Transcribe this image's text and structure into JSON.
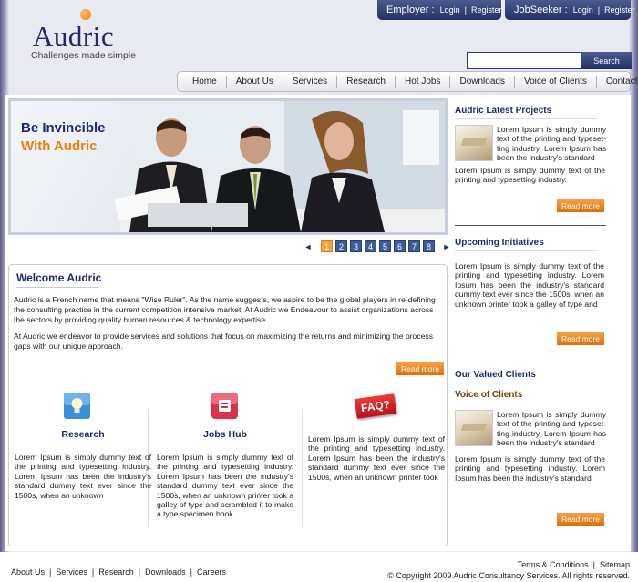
{
  "logo": {
    "wordmark": "Audric",
    "tagline": "Challenges made simple"
  },
  "employer": {
    "title": "Employer :",
    "login": "Login",
    "sep": "|",
    "register": "Register"
  },
  "seeker": {
    "title": "JobSeeker :",
    "login": "Login",
    "sep": "|",
    "register": "Register"
  },
  "search": {
    "placeholder": "",
    "button": "Search"
  },
  "nav": [
    "Home",
    "About Us",
    "Services",
    "Research",
    "Hot Jobs",
    "Downloads",
    "Voice of Clients",
    "Contact Us"
  ],
  "banner": {
    "line1": "Be Invincible",
    "line2": "With Audric"
  },
  "pager": {
    "prev": "◄",
    "next": "►",
    "pages": [
      "1",
      "2",
      "3",
      "4",
      "5",
      "6",
      "7",
      "8"
    ],
    "active": "1"
  },
  "welcome": {
    "title": "Welcome Audric",
    "para1": "Audric is a French name that means \"Wise Ruler\".  As the name suggests, we aspire to be the global players in re-defining the consulting practice in the current competition intensive market. At Audric we Endeavour to assist organizations across the sectors by providing quality human resources & technology expertise.",
    "para2": "At Audric we endeavor to provide services and solutions that focus on maximizing the returns and minimizing the process gaps with our unique approach.",
    "read_more": "Read more"
  },
  "features": [
    {
      "title": "Research",
      "icon": "lightbulb-icon",
      "text": "Lorem Ipsum is simply dummy text of the printing and typesetting industry. Lorem Ipsum has been the industry's standard dummy text ever since the 1500s, when an unknown"
    },
    {
      "title": "Jobs Hub",
      "icon": "jobs-hub-icon",
      "text": "Lorem Ipsum is simply dummy text of the printing and typesetting industry. Lorem Ipsum has been the industry's standard dummy text ever since the 1500s, when an unknown printer took a galley of type and scrambled it to make a type specimen book."
    },
    {
      "title": "",
      "icon": "faq-icon",
      "text": "Lorem Ipsum is simply dummy text of the printing and typesetting industry. Lorem Ipsum has been the industry's standard dummy text ever since the 1500s, when an unknown printer took"
    }
  ],
  "faq_badge": "FAQ?",
  "right": {
    "projects_title": "Audric Latest Projects",
    "projects_text1": "Lorem Ipsum is simply dummy text of the printing and typeset-ting industry. Lorem Ipsum has been the industry's standard",
    "projects_text2": "Lorem Ipsum is simply dummy text of the printing and typesetting industry.",
    "upcoming_title": "Upcoming Initiatives",
    "upcoming_text": "Lorem Ipsum is simply dummy text of the printing and typesetting industry. Lorem Ipsum has been the industry's standard dummy text ever since the 1500s, when an unknown printer took a galley of type and",
    "clients_title": "Our Valued Clients",
    "voice_title": "Voice of Clients",
    "voice_text1": "Lorem Ipsum is simply dummy text of the printing and typeset-ting industry. Lorem Ipsum has been the industry's standard",
    "voice_text2": "Lorem Ipsum is simply dummy text of the printing and typesetting industry. Lorem Ipsum has been the industry's standard",
    "read_more": "Read more"
  },
  "footer": {
    "links": [
      "About Us",
      "Services",
      "Research",
      "Downloads",
      "Careers"
    ],
    "terms": "Terms & Conditions",
    "sitemap": "Sitemap",
    "copyright": "© Copyright 2009 Audric Consultancy Services. All rights reserved."
  },
  "colors": {
    "navy": "#1e2a6c",
    "orange": "#ef7d0d",
    "header_button": "#243066"
  }
}
